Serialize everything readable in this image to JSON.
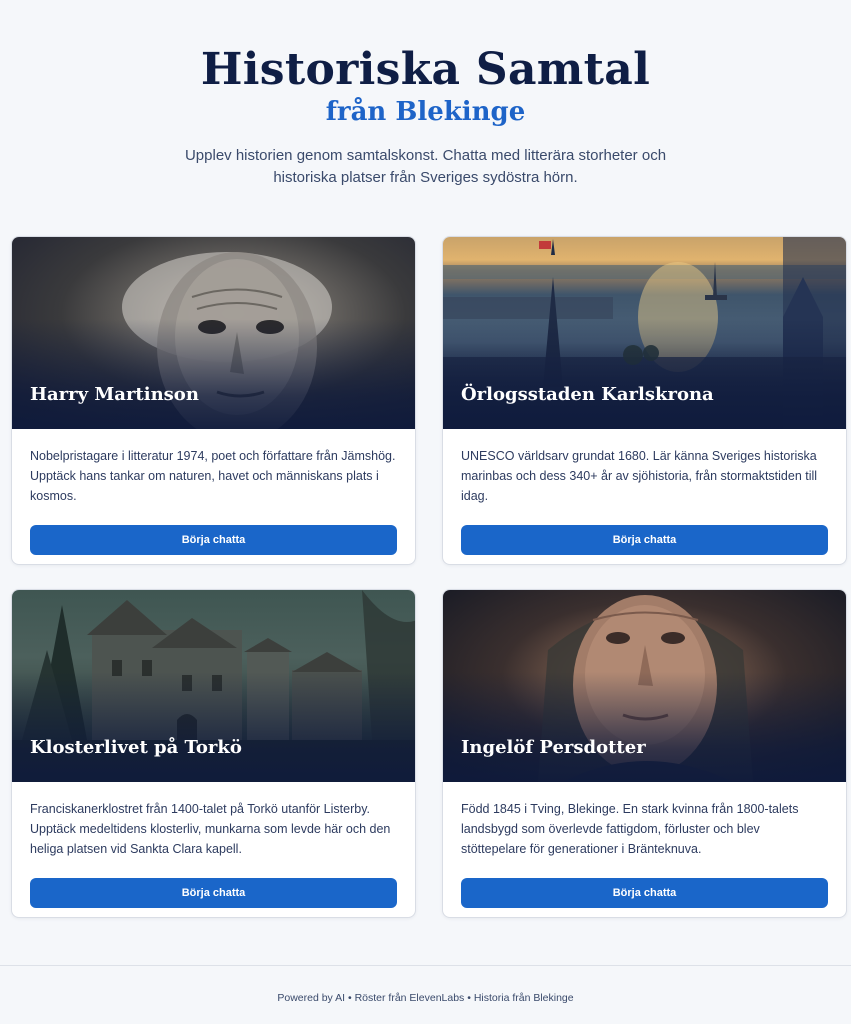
{
  "header": {
    "title": "Historiska Samtal",
    "subtitle": "från Blekinge",
    "intro": "Upplev historien genom samtalskonst. Chatta med litterära storheter och historiska platser från Sveriges sydöstra hörn."
  },
  "cards": [
    {
      "title": "Harry Martinson",
      "description": "Nobelpristagare i litteratur 1974, poet och författare från Jämshög. Upptäck hans tankar om naturen, havet och människans plats i kosmos.",
      "button": "Börja chatta"
    },
    {
      "title": "Örlogsstaden Karlskrona",
      "description": "UNESCO världsarv grundat 1680. Lär känna Sveriges historiska marinbas och dess 340+ år av sjöhistoria, från stormaktstiden till idag.",
      "button": "Börja chatta"
    },
    {
      "title": "Klosterlivet på Torkö",
      "description": "Franciskanerklostret från 1400-talet på Torkö utanför Listerby. Upptäck medeltidens klosterliv, munkarna som levde här och den heliga platsen vid Sankta Clara kapell.",
      "button": "Börja chatta"
    },
    {
      "title": "Ingelöf Persdotter",
      "description": "Född 1845 i Tving, Blekinge. En stark kvinna från 1800-talets landsbygd som överlevde fattigdom, förluster och blev stöttepelare för generationer i Bränteknuva.",
      "button": "Börja chatta"
    }
  ],
  "footer": {
    "text": "Powered by AI • Röster från ElevenLabs • Historia från Blekinge"
  },
  "colors": {
    "background": "#f5f7fa",
    "title": "#0f1e45",
    "accent": "#1e64c8",
    "button": "#1a66c9"
  }
}
